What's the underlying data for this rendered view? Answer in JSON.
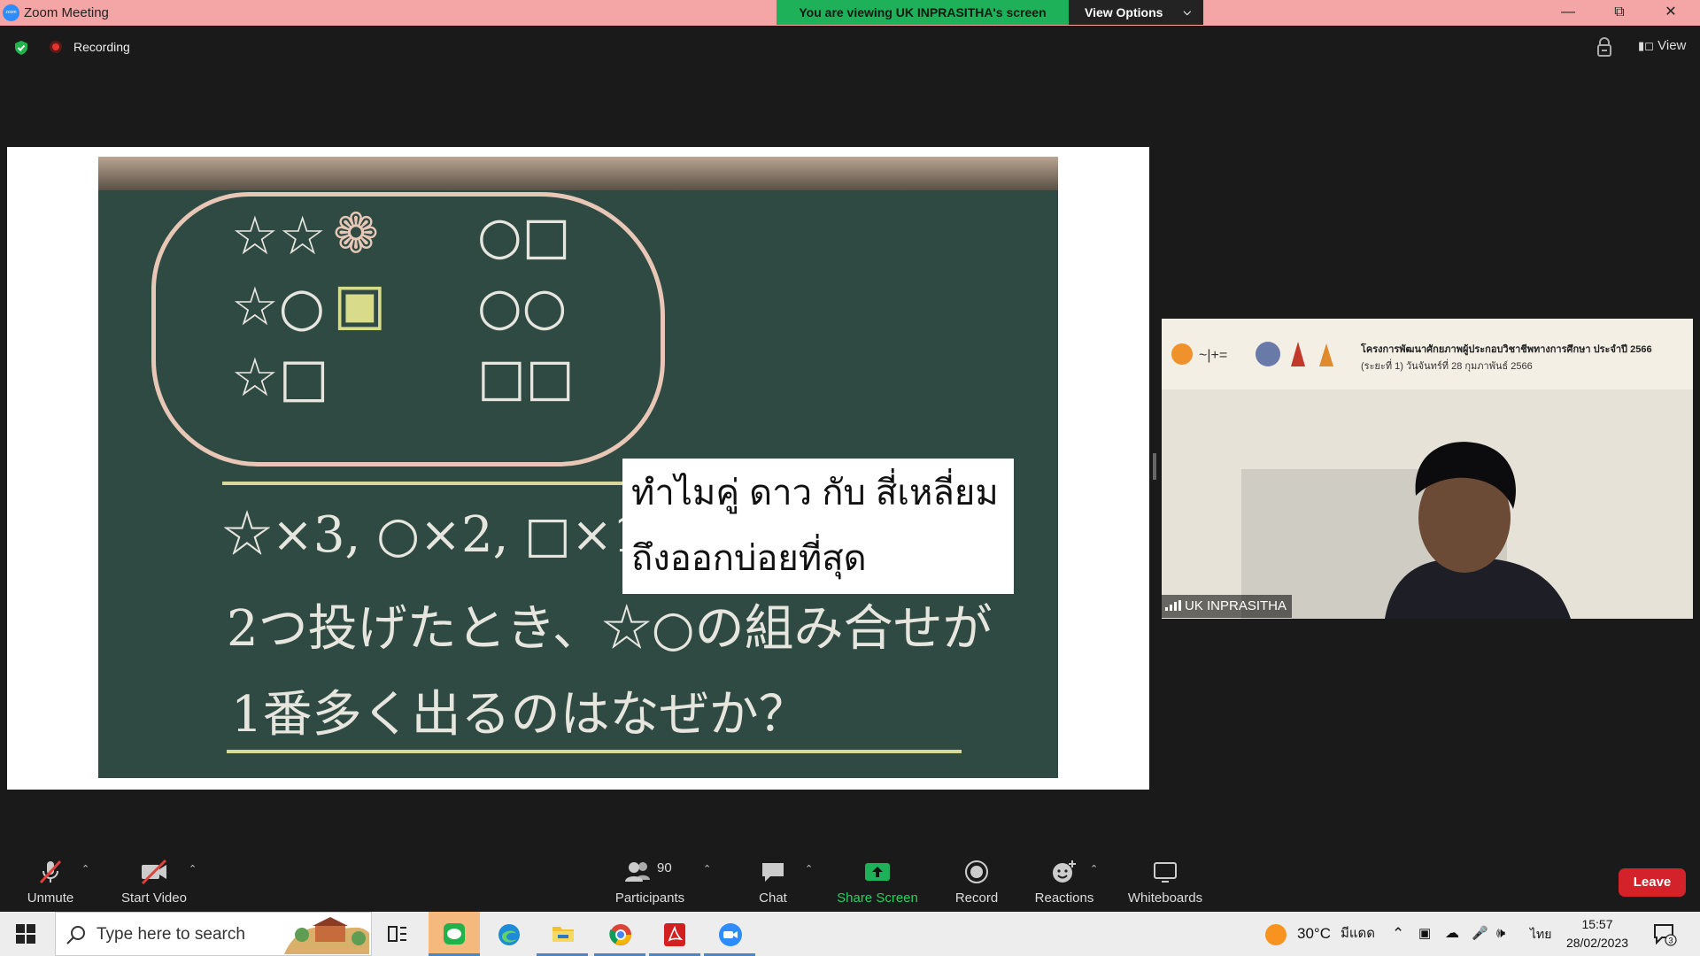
{
  "titlebar": {
    "title": "Zoom Meeting",
    "viewing": "You are viewing UK INPRASITHA's screen",
    "view_options": "View Options",
    "logo_text": "zoom"
  },
  "meeting": {
    "recording": "Recording",
    "view": "View"
  },
  "share": {
    "caption_line1": "ทำไมคู่ ดาว กับ สี่เหลี่ยม",
    "caption_line2": "ถึงออกบ่อยที่สุด",
    "board_line1": "☆×3, ○×2, □×1, のサイコロを",
    "board_line2": "2つ投げたとき、☆○の組み合せが",
    "board_line3": "1番多く出るのはなぜか？",
    "cloud_row1a": "☆☆",
    "cloud_row1b": "○□",
    "cloud_row2a": "☆○",
    "cloud_row2b": "○○",
    "cloud_row3a": "☆□",
    "cloud_row3b": "□□"
  },
  "participant": {
    "name": "UK INPRASITHA",
    "banner_title": "โครงการพัฒนาศักยภาพผู้ประกอบวิชาชีพทางการศึกษา ประจำปี 2566",
    "banner_sub": "(ระยะที่ 1)   วันจันทร์ที่ 28 กุมภาพันธ์ 2566"
  },
  "toolbar": {
    "unmute": "Unmute",
    "start_video": "Start Video",
    "participants": "Participants",
    "participants_count": "90",
    "chat": "Chat",
    "share_screen": "Share Screen",
    "record": "Record",
    "reactions": "Reactions",
    "whiteboards": "Whiteboards",
    "leave": "Leave"
  },
  "taskbar": {
    "search_placeholder": "Type here to search",
    "weather": "30°C",
    "weather_text": "มีแดด",
    "lang": "ไทย",
    "time": "15:57",
    "date": "28/02/2023",
    "notif_count": "3"
  },
  "colors": {
    "titlebar": "#f4a6a6",
    "viewing_green": "#1fb05a",
    "leave_red": "#d3222a",
    "board": "#2f4a43",
    "share_green": "#1fb05a"
  }
}
